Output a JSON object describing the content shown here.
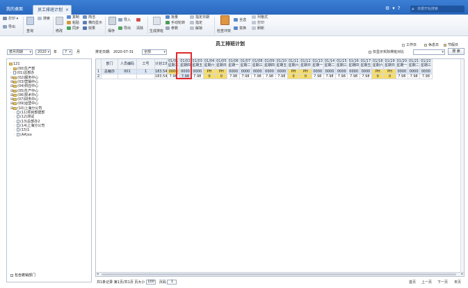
{
  "titlebar": {
    "tabs": [
      {
        "label": "我的桌面"
      },
      {
        "label": "员工排班计划"
      }
    ],
    "search_placeholder": "单据开始搜索"
  },
  "ribbon": {
    "groups": [
      {
        "items": [
          "打印",
          "导出"
        ]
      },
      {
        "big": "查询",
        "items": [
          "查询",
          "搜索"
        ]
      },
      {
        "big": "修改",
        "items": [
          "复制",
          "粘贴",
          "同步"
        ]
      },
      {
        "items": [
          "简洁",
          "横向显示",
          "效果"
        ]
      },
      {
        "items": [
          "保存",
          "导入",
          "导出",
          "清除"
        ]
      },
      {
        "big": "生成排班",
        "items": [
          "批量",
          "手动轮转",
          "参数"
        ]
      },
      {
        "items": [
          "指定日期",
          "指定",
          "解锁"
        ]
      },
      {
        "big": "检查冲突",
        "items": [
          "全选",
          "全选",
          "变换"
        ]
      },
      {
        "items": [
          "列格式",
          "打印",
          "刷新"
        ]
      }
    ]
  },
  "page": {
    "title": "员工排班计划",
    "legend": [
      {
        "label": "工作日",
        "color": "#ffffff"
      },
      {
        "label": "休息日",
        "color": "#f3e27a"
      },
      {
        "label": "节假日",
        "color": "#f6c040"
      }
    ],
    "filter": {
      "type_value": "按月周期",
      "year_value": "2020",
      "year_unit": "年",
      "month_value": "7",
      "month_unit": "月",
      "date_label": "排定日期:",
      "date_value": "2020-07-31",
      "scope_value": "全部",
      "only_show_label": "仅显示实际排班对比",
      "search_button": "搜 索"
    }
  },
  "tree": {
    "root": "121",
    "nodes": [
      {
        "label": "(00)生产部",
        "type": "folder",
        "level": 1
      },
      {
        "label": "(01)总部办",
        "type": "doc",
        "level": 1
      },
      {
        "label": "(02)服务中心",
        "type": "folder",
        "level": 1,
        "expand": true
      },
      {
        "label": "(03)营销中心",
        "type": "folder",
        "level": 1,
        "expand": true
      },
      {
        "label": "(04)供应中心",
        "type": "folder",
        "level": 1,
        "expand": true
      },
      {
        "label": "(05)生产中心",
        "type": "folder",
        "level": 1,
        "expand": true
      },
      {
        "label": "(06)技术中心",
        "type": "folder",
        "level": 1,
        "expand": true
      },
      {
        "label": "(07)财务中心",
        "type": "folder",
        "level": 1,
        "expand": true
      },
      {
        "label": "(09)运营中心",
        "type": "folder",
        "level": 1,
        "expand": true
      },
      {
        "label": "(10)上海分公司",
        "type": "folder",
        "level": 1,
        "expand": true
      },
      {
        "label": "(11)项目部建部",
        "type": "doc",
        "level": 2
      },
      {
        "label": "(12)测试",
        "type": "doc",
        "level": 2
      },
      {
        "label": "(13)总部办2",
        "type": "doc",
        "level": 2
      },
      {
        "label": "(14)上海分公司",
        "type": "doc",
        "level": 2
      },
      {
        "label": "(15)1",
        "type": "doc",
        "level": 2
      },
      {
        "label": "(AA)xx",
        "type": "doc",
        "level": 2
      }
    ],
    "footer_checkbox": "包含撤销部门"
  },
  "grid": {
    "fixed_headers": [
      "部门",
      "人员编码",
      "工号",
      "计划工时"
    ],
    "day_headers": [
      {
        "d": "01/01",
        "w": "星期三"
      },
      {
        "d": "01/02",
        "w": "星期四"
      },
      {
        "d": "01/03",
        "w": "星期五"
      },
      {
        "d": "01/04",
        "w": "星期六"
      },
      {
        "d": "01/05",
        "w": "星期日"
      },
      {
        "d": "01/06",
        "w": "星期一"
      },
      {
        "d": "01/07",
        "w": "星期二"
      },
      {
        "d": "01/08",
        "w": "星期三"
      },
      {
        "d": "01/09",
        "w": "星期四"
      },
      {
        "d": "01/10",
        "w": "星期五"
      },
      {
        "d": "01/11",
        "w": "星期六"
      },
      {
        "d": "01/12",
        "w": "星期日"
      },
      {
        "d": "01/13",
        "w": "星期一"
      },
      {
        "d": "01/14",
        "w": "星期二"
      },
      {
        "d": "01/15",
        "w": "星期三"
      },
      {
        "d": "01/16",
        "w": "星期四"
      },
      {
        "d": "01/17",
        "w": "星期五"
      },
      {
        "d": "01/18",
        "w": "星期六"
      },
      {
        "d": "01/19",
        "w": "星期日"
      },
      {
        "d": "01/20",
        "w": "星期一"
      },
      {
        "d": "01/21",
        "w": "星期二"
      },
      {
        "d": "01/22",
        "w": "星期三"
      }
    ],
    "rows": [
      {
        "num": "1",
        "fixed": [
          "总裁办",
          "001",
          "1",
          "183.54"
        ],
        "days": [
          "0000",
          "0000",
          "0000",
          "PH",
          "PH",
          "0000",
          "0000",
          "0000",
          "0000",
          "0000",
          "PH",
          "PH",
          "0000",
          "0000",
          "0000",
          "0000",
          "0000",
          "PH",
          "PH",
          "0000",
          "0000",
          "0000"
        ]
      },
      {
        "num": "2",
        "fixed": [
          "",
          "",
          "",
          "183.54"
        ],
        "days": [
          "7.98",
          "7.98",
          "7.98",
          "0",
          "0",
          "7.98",
          "7.98",
          "7.98",
          "7.98",
          "7.98",
          "0",
          "0",
          "7.98",
          "7.98",
          "7.98",
          "7.98",
          "7.98",
          "0",
          "0",
          "7.98",
          "7.98",
          "7.98"
        ]
      }
    ],
    "holiday_color": "#f6dc6a",
    "highlight_color": "#e0282e"
  },
  "pager": {
    "summary": "共1条记录  第1页/共1页  页大小",
    "page_size": "100",
    "page_label": "页码",
    "page_value": "1",
    "first": "首页",
    "prev": "上一页",
    "next": "下一页",
    "last": "末页"
  }
}
